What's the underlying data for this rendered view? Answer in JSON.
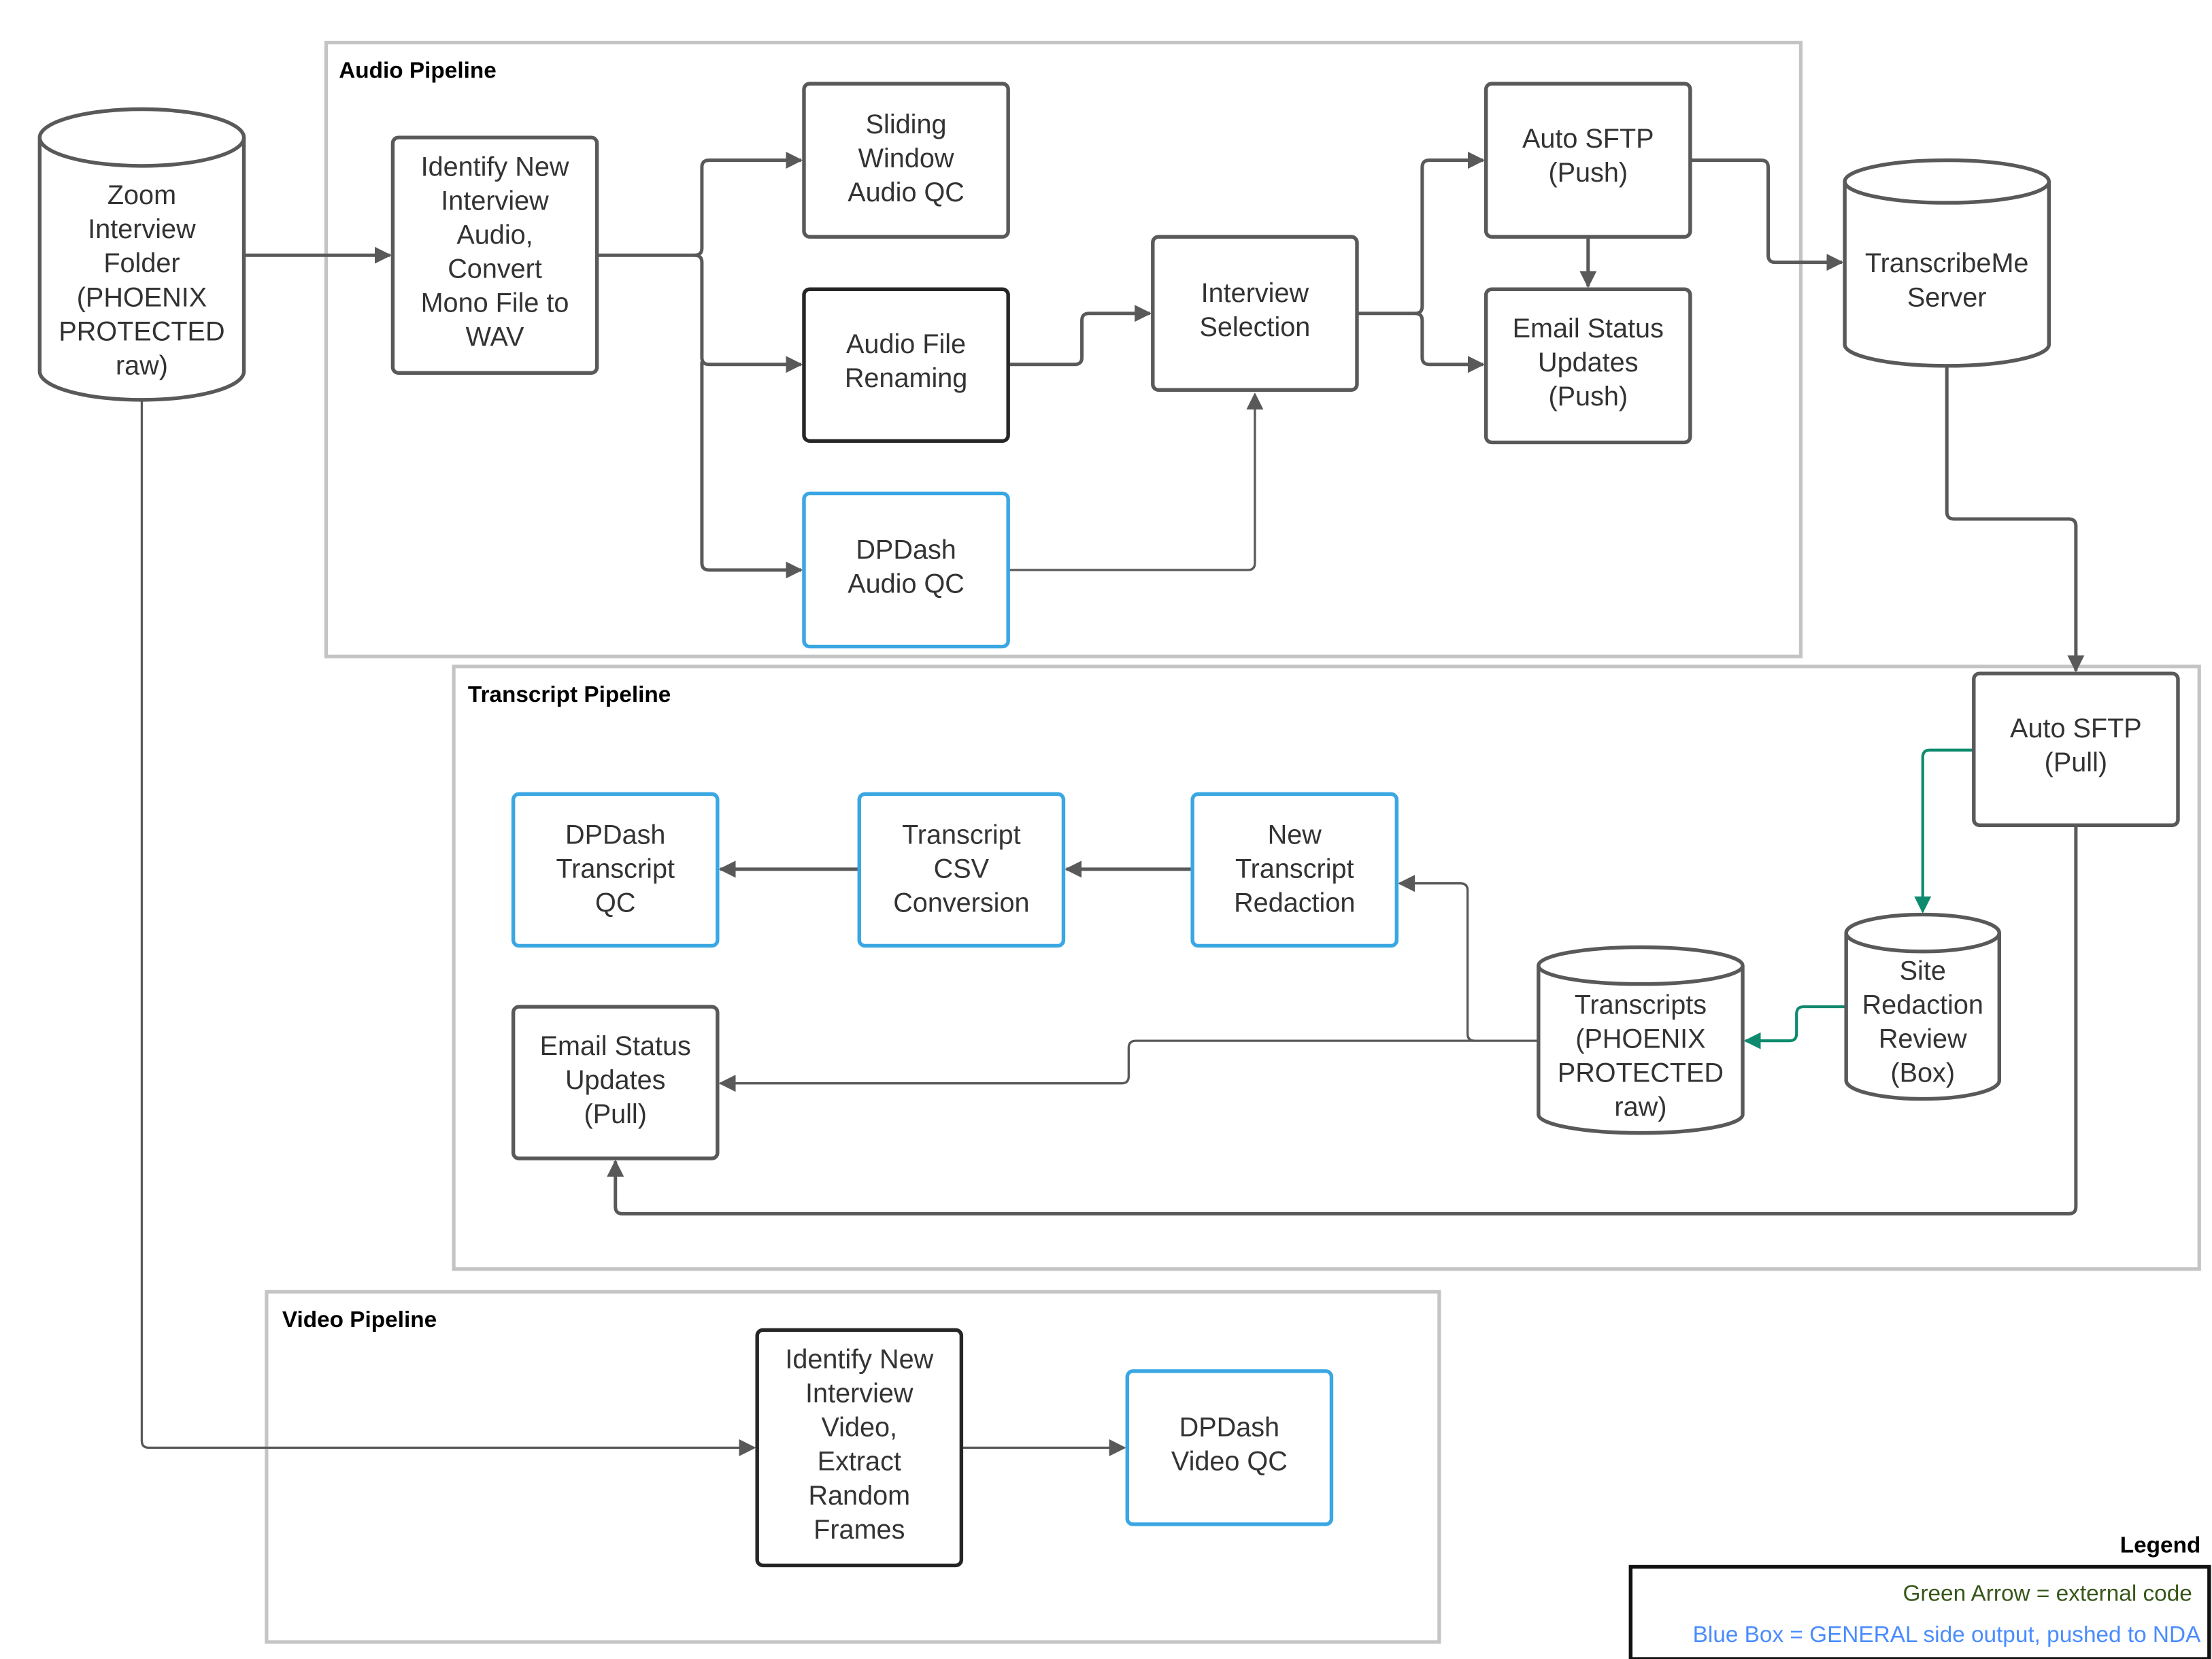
{
  "frames": {
    "audio": "Audio Pipeline",
    "transcript": "Transcript Pipeline",
    "video": "Video Pipeline"
  },
  "nodes": {
    "zoom": {
      "shape": "cylinder",
      "style": "gray",
      "lines": [
        "Zoom",
        "Interview",
        "Folder",
        "(PHOENIX",
        "PROTECTED",
        "raw)"
      ]
    },
    "identify_audio": {
      "shape": "box",
      "style": "gray",
      "lines": [
        "Identify New",
        "Interview",
        "Audio,",
        "Convert",
        "Mono File to",
        "WAV"
      ]
    },
    "sliding_qc": {
      "shape": "box",
      "style": "gray",
      "lines": [
        "Sliding",
        "Window",
        "Audio QC"
      ]
    },
    "renaming": {
      "shape": "box",
      "style": "dark",
      "lines": [
        "Audio File",
        "Renaming"
      ]
    },
    "dpdash_audio": {
      "shape": "box",
      "style": "blue",
      "lines": [
        "DPDash",
        "Audio QC"
      ]
    },
    "selection": {
      "shape": "box",
      "style": "gray",
      "lines": [
        "Interview",
        "Selection"
      ]
    },
    "sftp_push": {
      "shape": "box",
      "style": "gray",
      "lines": [
        "Auto SFTP",
        "(Push)"
      ]
    },
    "email_push": {
      "shape": "box",
      "style": "gray",
      "lines": [
        "Email Status",
        "Updates",
        "(Push)"
      ]
    },
    "transcribeme": {
      "shape": "cylinder",
      "style": "gray",
      "lines": [
        "TranscribeMe",
        "Server"
      ]
    },
    "sftp_pull": {
      "shape": "box",
      "style": "gray",
      "lines": [
        "Auto SFTP",
        "(Pull)"
      ]
    },
    "site_review": {
      "shape": "cylinder",
      "style": "gray",
      "lines": [
        "Site",
        "Redaction",
        "Review",
        "(Box)"
      ]
    },
    "transcripts": {
      "shape": "cylinder",
      "style": "gray",
      "lines": [
        "Transcripts",
        "(PHOENIX",
        "PROTECTED",
        "raw)"
      ]
    },
    "redaction": {
      "shape": "box",
      "style": "blue",
      "lines": [
        "New",
        "Transcript",
        "Redaction"
      ]
    },
    "csv": {
      "shape": "box",
      "style": "blue",
      "lines": [
        "Transcript",
        "CSV",
        "Conversion"
      ]
    },
    "dpdash_transcript": {
      "shape": "box",
      "style": "blue",
      "lines": [
        "DPDash",
        "Transcript",
        "QC"
      ]
    },
    "email_pull": {
      "shape": "box",
      "style": "gray",
      "lines": [
        "Email Status",
        "Updates",
        "(Pull)"
      ]
    },
    "identify_video": {
      "shape": "box",
      "style": "dark",
      "lines": [
        "Identify New",
        "Interview",
        "Video,",
        "Extract",
        "Random",
        "Frames"
      ]
    },
    "dpdash_video": {
      "shape": "box",
      "style": "blue",
      "lines": [
        "DPDash",
        "Video QC"
      ]
    }
  },
  "edges": [
    {
      "from": "zoom",
      "to": "identify_audio",
      "type": "standard"
    },
    {
      "from": "identify_audio",
      "to": "sliding_qc",
      "type": "standard"
    },
    {
      "from": "identify_audio",
      "to": "renaming",
      "type": "standard"
    },
    {
      "from": "identify_audio",
      "to": "dpdash_audio",
      "type": "standard"
    },
    {
      "from": "renaming",
      "to": "selection",
      "type": "standard"
    },
    {
      "from": "dpdash_audio",
      "to": "selection",
      "type": "standard"
    },
    {
      "from": "selection",
      "to": "sftp_push",
      "type": "standard"
    },
    {
      "from": "selection",
      "to": "email_push",
      "type": "standard"
    },
    {
      "from": "sftp_push",
      "to": "email_push",
      "type": "standard"
    },
    {
      "from": "sftp_push",
      "to": "transcribeme",
      "type": "standard"
    },
    {
      "from": "transcribeme",
      "to": "sftp_pull",
      "type": "standard"
    },
    {
      "from": "sftp_pull",
      "to": "site_review",
      "type": "external"
    },
    {
      "from": "site_review",
      "to": "transcripts",
      "type": "external"
    },
    {
      "from": "transcripts",
      "to": "redaction",
      "type": "standard"
    },
    {
      "from": "transcripts",
      "to": "email_pull",
      "type": "standard"
    },
    {
      "from": "sftp_pull",
      "to": "email_pull",
      "type": "standard"
    },
    {
      "from": "redaction",
      "to": "csv",
      "type": "standard"
    },
    {
      "from": "csv",
      "to": "dpdash_transcript",
      "type": "standard"
    },
    {
      "from": "zoom",
      "to": "identify_video",
      "type": "standard"
    },
    {
      "from": "identify_video",
      "to": "dpdash_video",
      "type": "standard"
    }
  ],
  "legend": {
    "title": "Legend",
    "green_arrow": "Green Arrow = external code",
    "blue_box": "Blue Box = GENERAL side output, pushed to NDA"
  },
  "colors": {
    "box_stroke": "#595959",
    "dark_box_stroke": "#262626",
    "blue_box_stroke": "#3aa7e3",
    "green_arrow": "#0e8a6e",
    "frame_stroke": "#c4c4c4",
    "legend_green_text": "#38571a",
    "legend_blue_text": "#4a8cff"
  }
}
